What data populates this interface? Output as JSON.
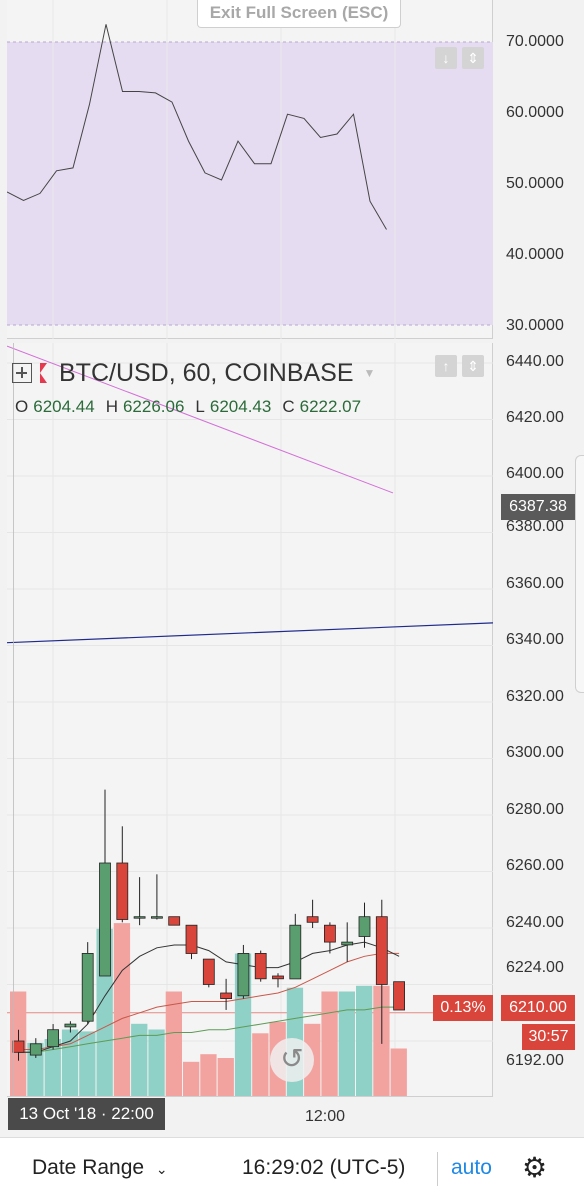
{
  "exit_fullscreen": "Exit Full Screen (ESC)",
  "indicator_pane": {
    "axis_labels": [
      "70.0000",
      "60.0000",
      "50.0000",
      "40.0000",
      "30.0000"
    ],
    "band": {
      "upper": 70,
      "lower": 30,
      "color": "#e6dcf2"
    },
    "rsi_values": [
      48.8,
      47.6,
      48.6,
      51.8,
      52.2,
      61.2,
      72.5,
      63.0,
      63.0,
      62.8,
      61.5,
      56.0,
      51.5,
      50.5,
      56.0,
      52.8,
      52.8,
      59.8,
      59.2,
      56.5,
      57.0,
      59.8,
      47.5,
      43.5
    ]
  },
  "symbol": {
    "name": "BTC/USD, 60, COINBASE",
    "ohlc": {
      "o_label": "O",
      "o": "6204.44",
      "h_label": "H",
      "h": "6226.06",
      "l_label": "L",
      "l": "6204.43",
      "c_label": "C",
      "c": "6222.07"
    }
  },
  "price_axis": [
    "6440.00",
    "6420.00",
    "6400.00",
    "6380.00",
    "6360.00",
    "6340.00",
    "6320.00",
    "6300.00",
    "6280.00",
    "6260.00",
    "6240.00",
    "6224.00",
    "6192.00"
  ],
  "tags": {
    "line_price": "6387.38",
    "change_pct": "0.13%",
    "last_price": "6210.00",
    "countdown": "30:57"
  },
  "colors": {
    "up": "#5a9e6f",
    "down": "#d9453a",
    "vol_up": "#8fd1c6",
    "vol_down": "#f2a3a0",
    "accent": "#1e88e5"
  },
  "time_axis": {
    "cursor_label": "13 Oct '18 · 22:00",
    "tick": "12:00"
  },
  "bottom_bar": {
    "date_range": "Date Range",
    "time": "16:29:02 (UTC-5)",
    "auto": "auto"
  },
  "chart_data": {
    "type": "candlestick",
    "candles": [
      {
        "o": 6200,
        "h": 6204,
        "l": 6193,
        "c": 6196
      },
      {
        "o": 6195,
        "h": 6201,
        "l": 6194,
        "c": 6199
      },
      {
        "o": 6198,
        "h": 6206,
        "l": 6197,
        "c": 6204
      },
      {
        "o": 6205,
        "h": 6207,
        "l": 6203,
        "c": 6206
      },
      {
        "o": 6207,
        "h": 6235,
        "l": 6206,
        "c": 6231
      },
      {
        "o": 6223,
        "h": 6289,
        "l": 6223,
        "c": 6263
      },
      {
        "o": 6263,
        "h": 6276,
        "l": 6242,
        "c": 6243
      },
      {
        "o": 6244,
        "h": 6258,
        "l": 6241,
        "c": 6244
      },
      {
        "o": 6244,
        "h": 6259,
        "l": 6243,
        "c": 6244
      },
      {
        "o": 6244,
        "h": 6244,
        "l": 6241,
        "c": 6241
      },
      {
        "o": 6241,
        "h": 6241,
        "l": 6229,
        "c": 6231
      },
      {
        "o": 6229,
        "h": 6229,
        "l": 6219,
        "c": 6220
      },
      {
        "o": 6217,
        "h": 6222,
        "l": 6211,
        "c": 6215
      },
      {
        "o": 6216,
        "h": 6234,
        "l": 6215,
        "c": 6231
      },
      {
        "o": 6231,
        "h": 6232,
        "l": 6221,
        "c": 6222
      },
      {
        "o": 6223,
        "h": 6224,
        "l": 6219,
        "c": 6222
      },
      {
        "o": 6222,
        "h": 6245,
        "l": 6222,
        "c": 6241
      },
      {
        "o": 6244,
        "h": 6250,
        "l": 6240,
        "c": 6242
      },
      {
        "o": 6241,
        "h": 6242,
        "l": 6231,
        "c": 6235
      },
      {
        "o": 6234,
        "h": 6242,
        "l": 6228,
        "c": 6235
      },
      {
        "o": 6237,
        "h": 6249,
        "l": 6233,
        "c": 6244
      },
      {
        "o": 6244,
        "h": 6250,
        "l": 6199,
        "c": 6220
      },
      {
        "o": 6221,
        "h": 6221,
        "l": 6211,
        "c": 6211
      }
    ],
    "volumes": [
      0.55,
      0.28,
      0.3,
      0.35,
      0.34,
      0.88,
      0.91,
      0.38,
      0.35,
      0.55,
      0.18,
      0.22,
      0.2,
      0.75,
      0.33,
      0.39,
      0.57,
      0.38,
      0.55,
      0.55,
      0.58,
      0.58,
      0.25
    ],
    "ma_fast": [
      6196,
      6196,
      6198,
      6200,
      6206,
      6216,
      6225,
      6230,
      6233,
      6234,
      6234,
      6232,
      6228,
      6227,
      6226,
      6226,
      6228,
      6231,
      6232,
      6234,
      6235,
      6233,
      6230
    ],
    "ma_slow": [
      6197,
      6197,
      6198,
      6199,
      6202,
      6205,
      6208,
      6210,
      6212,
      6213,
      6214,
      6214,
      6214,
      6215,
      6216,
      6217,
      6219,
      6222,
      6225,
      6228,
      6230,
      6231,
      6231
    ],
    "ma_long": [
      6196,
      6196,
      6197,
      6198,
      6199,
      6200,
      6201,
      6202,
      6202,
      6203,
      6203,
      6204,
      6204,
      6205,
      6206,
      6207,
      6208,
      6209,
      6210,
      6211,
      6211,
      6212,
      6212
    ],
    "trend_magenta": [
      6446,
      6394
    ],
    "trend_navy": [
      6341,
      6348
    ],
    "y_min": 6186,
    "y_max": 6445
  }
}
